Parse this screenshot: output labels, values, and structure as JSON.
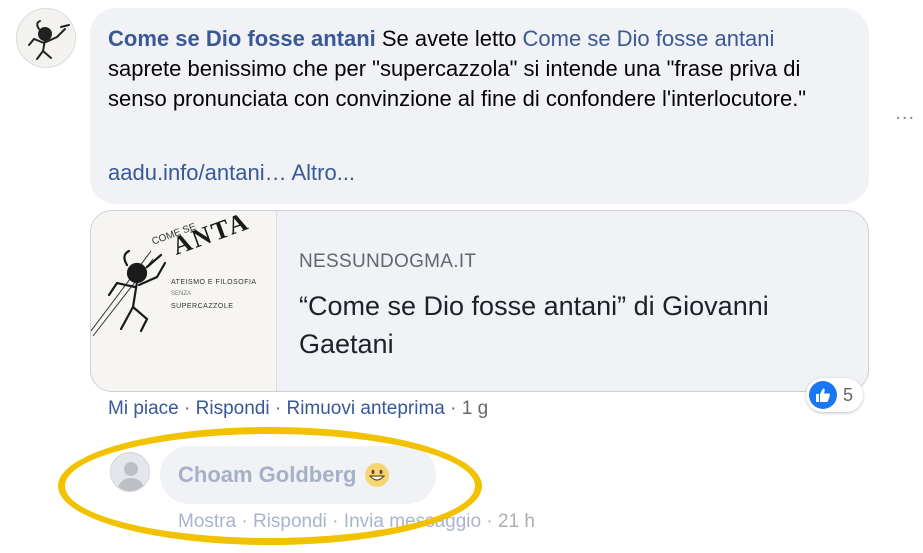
{
  "post": {
    "author": "Come se Dio fosse antani",
    "text_before_link": " Se avete letto ",
    "inline_link": "Come se Dio fosse antani",
    "text_after_link": " saprete benissimo che per \"supercazzola\" si intende una \"frase priva di senso pronunciata con convinzione al fine di confondere l'interlocutore.\"",
    "url_short": "aadu.info/antani…",
    "more_label": " Altro..."
  },
  "more_options": "...",
  "preview": {
    "domain": "NESSUNDOGMA.IT",
    "title": "“Come se Dio fosse antani” di Giovanni Gaetani",
    "thumb_text": {
      "small_top": "COME SE",
      "big": "ANTA",
      "line1": "ATEISMO E FILOSOFIA",
      "line2": "SENZA",
      "line3": "SUPERCAZZOLE"
    }
  },
  "reaction": {
    "count": "5",
    "icon": "like-icon",
    "color": "#1877f2"
  },
  "actions": {
    "like": "Mi piace",
    "reply": "Rispondi",
    "remove_preview": "Rimuovi anteprima",
    "time": "1 g",
    "separator": " · "
  },
  "reply": {
    "author": "Choam Goldberg",
    "emoji": "grinning-face-emoji",
    "actions": {
      "show": "Mostra",
      "reply": "Rispondi",
      "send_message": "Invia messaggio",
      "time": "21 h",
      "separator": " · "
    }
  },
  "highlight_color": "#f2c200"
}
